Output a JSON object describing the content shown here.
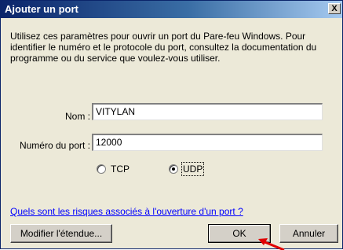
{
  "window": {
    "title": "Ajouter un port",
    "close_label": "X"
  },
  "description": "Utilisez ces paramètres pour ouvrir un port du Pare-feu Windows. Pour identifier le numéro et le protocole du port, consultez la documentation du programme ou du service que voulez-vous utiliser.",
  "form": {
    "name_label": "Nom :",
    "name_value": "VITYLAN",
    "port_label": "Numéro du port :",
    "port_value": "12000",
    "protocol": {
      "tcp_label": "TCP",
      "udp_label": "UDP",
      "selected": "UDP"
    }
  },
  "help_link": "Quels sont les risques associés à l'ouverture d'un port ?",
  "buttons": {
    "modify_scope": "Modifier l'étendue...",
    "ok": "OK",
    "cancel": "Annuler"
  },
  "colors": {
    "titlebar_start": "#0a246a",
    "link": "#0000ff",
    "arrow": "#e00000"
  }
}
